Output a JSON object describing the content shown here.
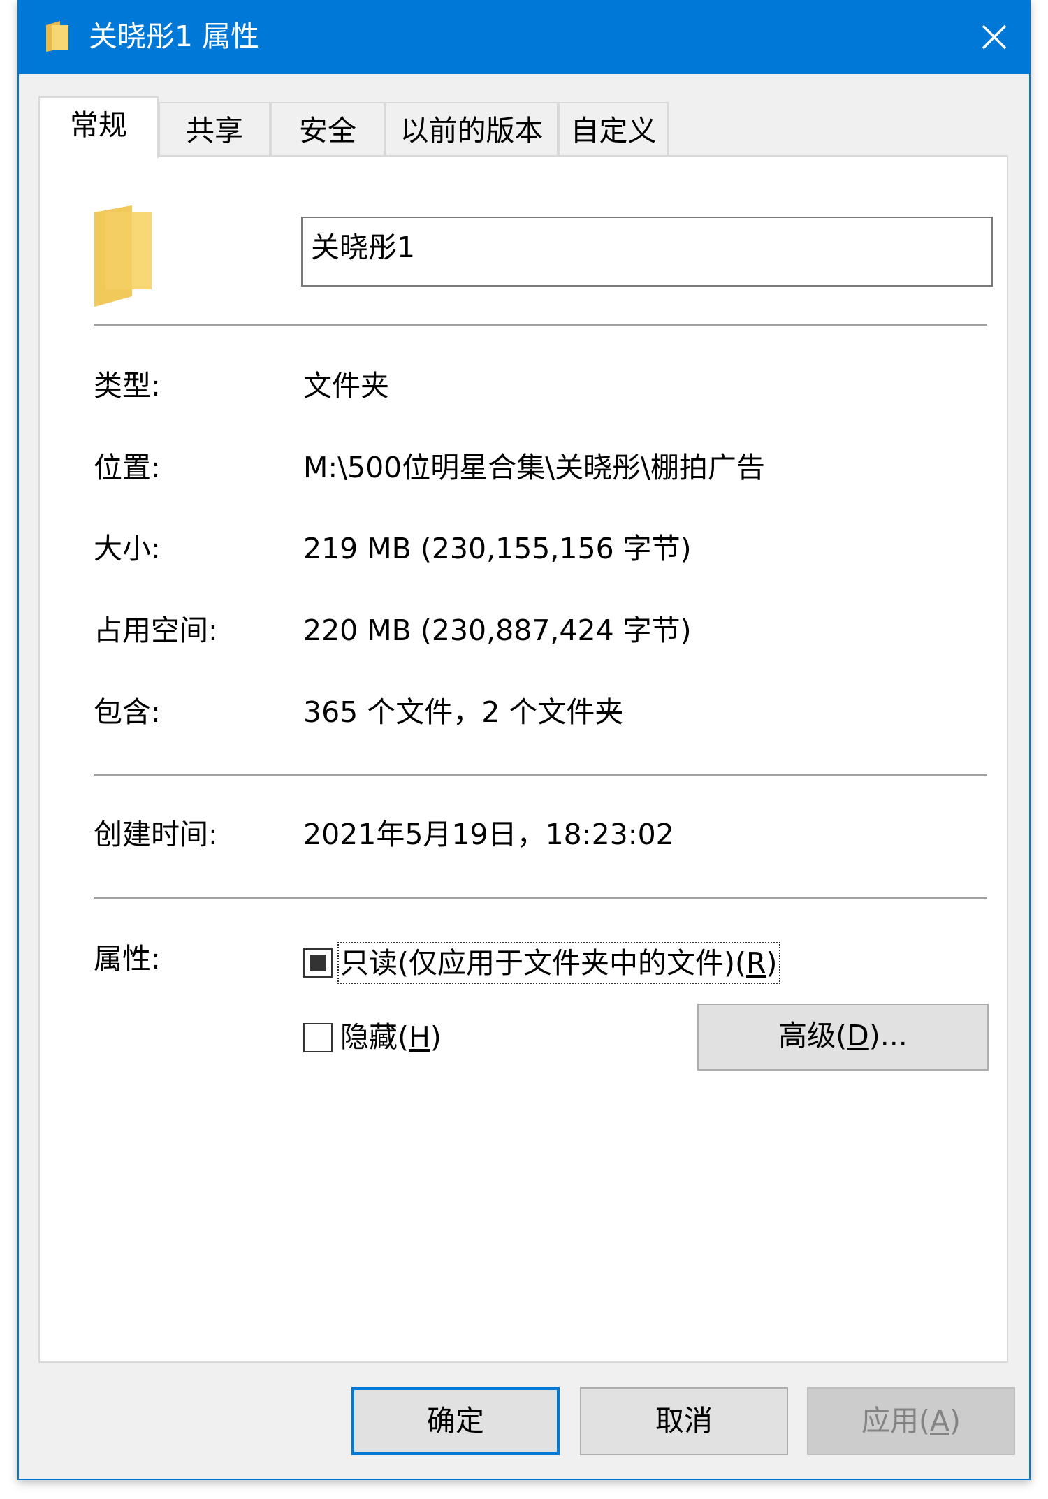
{
  "window": {
    "title": "关晓彤1 属性",
    "accent_color": "#0078d7",
    "title_icon": "folder-icon",
    "close_icon": "close-icon"
  },
  "tabs": [
    {
      "label": "常规",
      "active": true
    },
    {
      "label": "共享",
      "active": false
    },
    {
      "label": "安全",
      "active": false
    },
    {
      "label": "以前的版本",
      "active": false
    },
    {
      "label": "自定义",
      "active": false
    }
  ],
  "general": {
    "folder_icon": "folder-icon",
    "name_value": "关晓彤1",
    "type_label": "类型:",
    "type_value": "文件夹",
    "location_label": "位置:",
    "location_value": "M:\\500位明星合集\\关晓彤\\棚拍广告",
    "size_label": "大小:",
    "size_value": "219 MB (230,155,156 字节)",
    "disk_label": "占用空间:",
    "disk_value": "220 MB (230,887,424 字节)",
    "contains_label": "包含:",
    "contains_value": "365 个文件，2 个文件夹",
    "created_label": "创建时间:",
    "created_value": "2021年5月19日，18:23:02",
    "attributes_label": "属性:",
    "readonly_prefix": "只读(仅应用于文件夹中的文件)(",
    "readonly_key": "R",
    "readonly_suffix": ")",
    "readonly_state": "indeterminate",
    "hidden_prefix": "隐藏(",
    "hidden_key": "H",
    "hidden_suffix": ")",
    "hidden_state": "unchecked",
    "advanced_prefix": "高级(",
    "advanced_key": "D",
    "advanced_suffix": ")..."
  },
  "buttons": {
    "ok": "确定",
    "cancel": "取消",
    "apply_prefix": "应用(",
    "apply_key": "A",
    "apply_suffix": ")"
  }
}
